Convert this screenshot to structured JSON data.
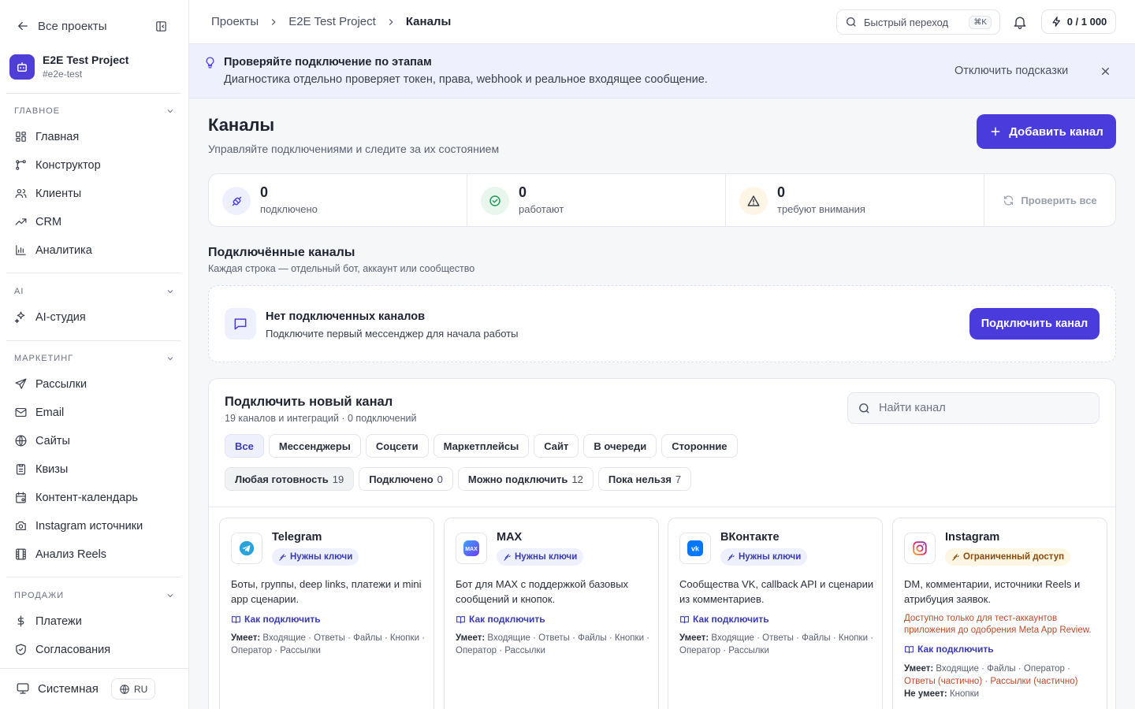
{
  "sidebar": {
    "back_label": "Все проекты",
    "project": {
      "name": "E2E Test Project",
      "slug": "#e2e-test"
    },
    "sections": [
      {
        "title": "ГЛАВНОЕ",
        "items": [
          {
            "label": "Главная",
            "icon": "dashboard-icon"
          },
          {
            "label": "Конструктор",
            "icon": "flow-icon"
          },
          {
            "label": "Клиенты",
            "icon": "users-icon"
          },
          {
            "label": "CRM",
            "icon": "trend-icon"
          },
          {
            "label": "Аналитика",
            "icon": "chart-icon"
          }
        ]
      },
      {
        "title": "AI",
        "items": [
          {
            "label": "AI-студия",
            "icon": "sparkles-icon"
          }
        ]
      },
      {
        "title": "МАРКЕТИНГ",
        "items": [
          {
            "label": "Рассылки",
            "icon": "send-icon"
          },
          {
            "label": "Email",
            "icon": "mail-icon"
          },
          {
            "label": "Сайты",
            "icon": "globe-icon"
          },
          {
            "label": "Квизы",
            "icon": "clipboard-icon"
          },
          {
            "label": "Контент-календарь",
            "icon": "calendar-icon"
          },
          {
            "label": "Instagram источники",
            "icon": "camera-icon"
          },
          {
            "label": "Анализ Reels",
            "icon": "film-icon"
          }
        ]
      },
      {
        "title": "ПРОДАЖИ",
        "items": [
          {
            "label": "Платежи",
            "icon": "dollar-icon"
          },
          {
            "label": "Согласования",
            "icon": "shield-check-icon"
          }
        ]
      }
    ],
    "theme_label": "Системная",
    "lang": "RU"
  },
  "topbar": {
    "breadcrumbs": [
      "Проекты",
      "E2E Test Project",
      "Каналы"
    ],
    "quick_jump": "Быстрый переход",
    "shortcut": "⌘K",
    "limit": "0 / 1 000"
  },
  "hint": {
    "title": "Проверяйте подключение по этапам",
    "text": "Диагностика отдельно проверяет токен, права, webhook и реальное входящее сообщение.",
    "disable": "Отключить подсказки"
  },
  "page": {
    "title": "Каналы",
    "subtitle": "Управляйте подключениями и следите за их состоянием",
    "add_button": "Добавить канал"
  },
  "stats": [
    {
      "value": "0",
      "label": "подключено",
      "color": "#4a3bdc"
    },
    {
      "value": "0",
      "label": "работают",
      "color": "#1f9d55"
    },
    {
      "value": "0",
      "label": "требуют внимания",
      "color": "#c27c0e"
    }
  ],
  "check_all": "Проверить все",
  "connected": {
    "title": "Подключённые каналы",
    "subtitle": "Каждая строка — отдельный бот, аккаунт или сообщество",
    "empty_title": "Нет подключенных каналов",
    "empty_text": "Подключите первый мессенджер для начала работы",
    "connect_button": "Подключить канал"
  },
  "catalog": {
    "title": "Подключить новый канал",
    "subtitle": "19 каналов и интеграций · 0 подключений",
    "search_placeholder": "Найти канал",
    "types": [
      "Все",
      "Мессенджеры",
      "Соцсети",
      "Маркетплейсы",
      "Сайт",
      "В очереди",
      "Сторонние"
    ],
    "readiness": [
      {
        "label": "Любая готовность",
        "count": "19"
      },
      {
        "label": "Подключено",
        "count": "0"
      },
      {
        "label": "Можно подключить",
        "count": "12"
      },
      {
        "label": "Пока нельзя",
        "count": "7"
      }
    ],
    "howto_label": "Как подключить",
    "caps_label": "Умеет:",
    "cannot_label": "Не умеет:",
    "cards": [
      {
        "name": "Telegram",
        "badge": "Нужны ключи",
        "desc": "Боты, группы, deep links, платежи и mini app сценарии.",
        "caps": "Входящие · Ответы · Файлы · Кнопки · Оператор · Рассылки"
      },
      {
        "name": "MAX",
        "badge": "Нужны ключи",
        "desc": "Бот для MAX с поддержкой базовых сообщений и кнопок.",
        "caps": "Входящие · Ответы · Файлы · Кнопки · Оператор · Рассылки"
      },
      {
        "name": "ВКонтакте",
        "badge": "Нужны ключи",
        "desc": "Сообщества VK, callback API и сценарии из комментариев.",
        "caps": "Входящие · Ответы · Файлы · Кнопки · Оператор · Рассылки"
      },
      {
        "name": "Instagram",
        "badge": "Ограниченный доступ",
        "desc": "DM, комментарии, источники Reels и атрибуция заявок.",
        "warn": "Доступно только для тест-аккаунтов приложения до одобрения Meta App Review.",
        "caps_a": "Входящие · Файлы · Оператор ·",
        "caps_b": "Ответы (частично) · Рассылки (частично)",
        "cannot": "Кнопки"
      }
    ]
  }
}
